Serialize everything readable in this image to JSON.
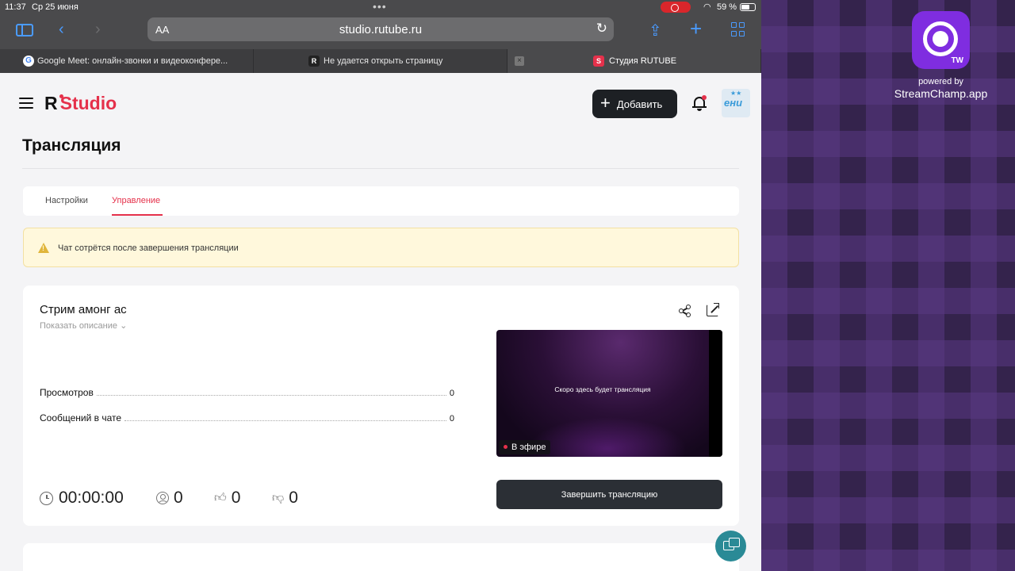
{
  "status_bar": {
    "time": "11:37",
    "date": "Ср 25 июня",
    "battery": "59 %"
  },
  "browser": {
    "text_size_label": "AA",
    "url": "studio.rutube.ru",
    "tabs": [
      {
        "label": "Google Meet: онлайн-звонки и видеоконфере...",
        "icon": "google-icon"
      },
      {
        "label": "Не удается открыть страницу",
        "icon": "rutube-r-icon"
      },
      {
        "label": "Студия RUTUBE",
        "icon": "rutube-studio-icon",
        "active": true
      }
    ]
  },
  "header": {
    "logo_r": "R",
    "logo_studio": "Studio",
    "add_button": "Добавить"
  },
  "page": {
    "title": "Трансляция",
    "tabs": {
      "settings": "Настройки",
      "manage": "Управление"
    },
    "notice": "Чат сотрётся после завершения трансляции"
  },
  "stream": {
    "title": "Стрим амонг ас",
    "show_description": "Показать описание",
    "stats": [
      {
        "label": "Просмотров",
        "value": "0"
      },
      {
        "label": "Сообщений в чате",
        "value": "0"
      }
    ],
    "preview_text": "Скоро здесь будет трансляция",
    "live_badge": "В эфире",
    "end_button": "Завершить трансляцию",
    "metrics": {
      "duration": "00:00:00",
      "viewers": "0",
      "likes": "0",
      "dislikes": "0"
    }
  },
  "overlay": {
    "app_badge": "TW",
    "powered_by": "powered by",
    "brand": "StreamChamp.app"
  },
  "colors": {
    "accent": "#e5314b",
    "dark_button": "#1d2024",
    "notice_bg": "#fff8dc",
    "fab": "#2a8a96",
    "app_icon": "#7f2de0"
  }
}
